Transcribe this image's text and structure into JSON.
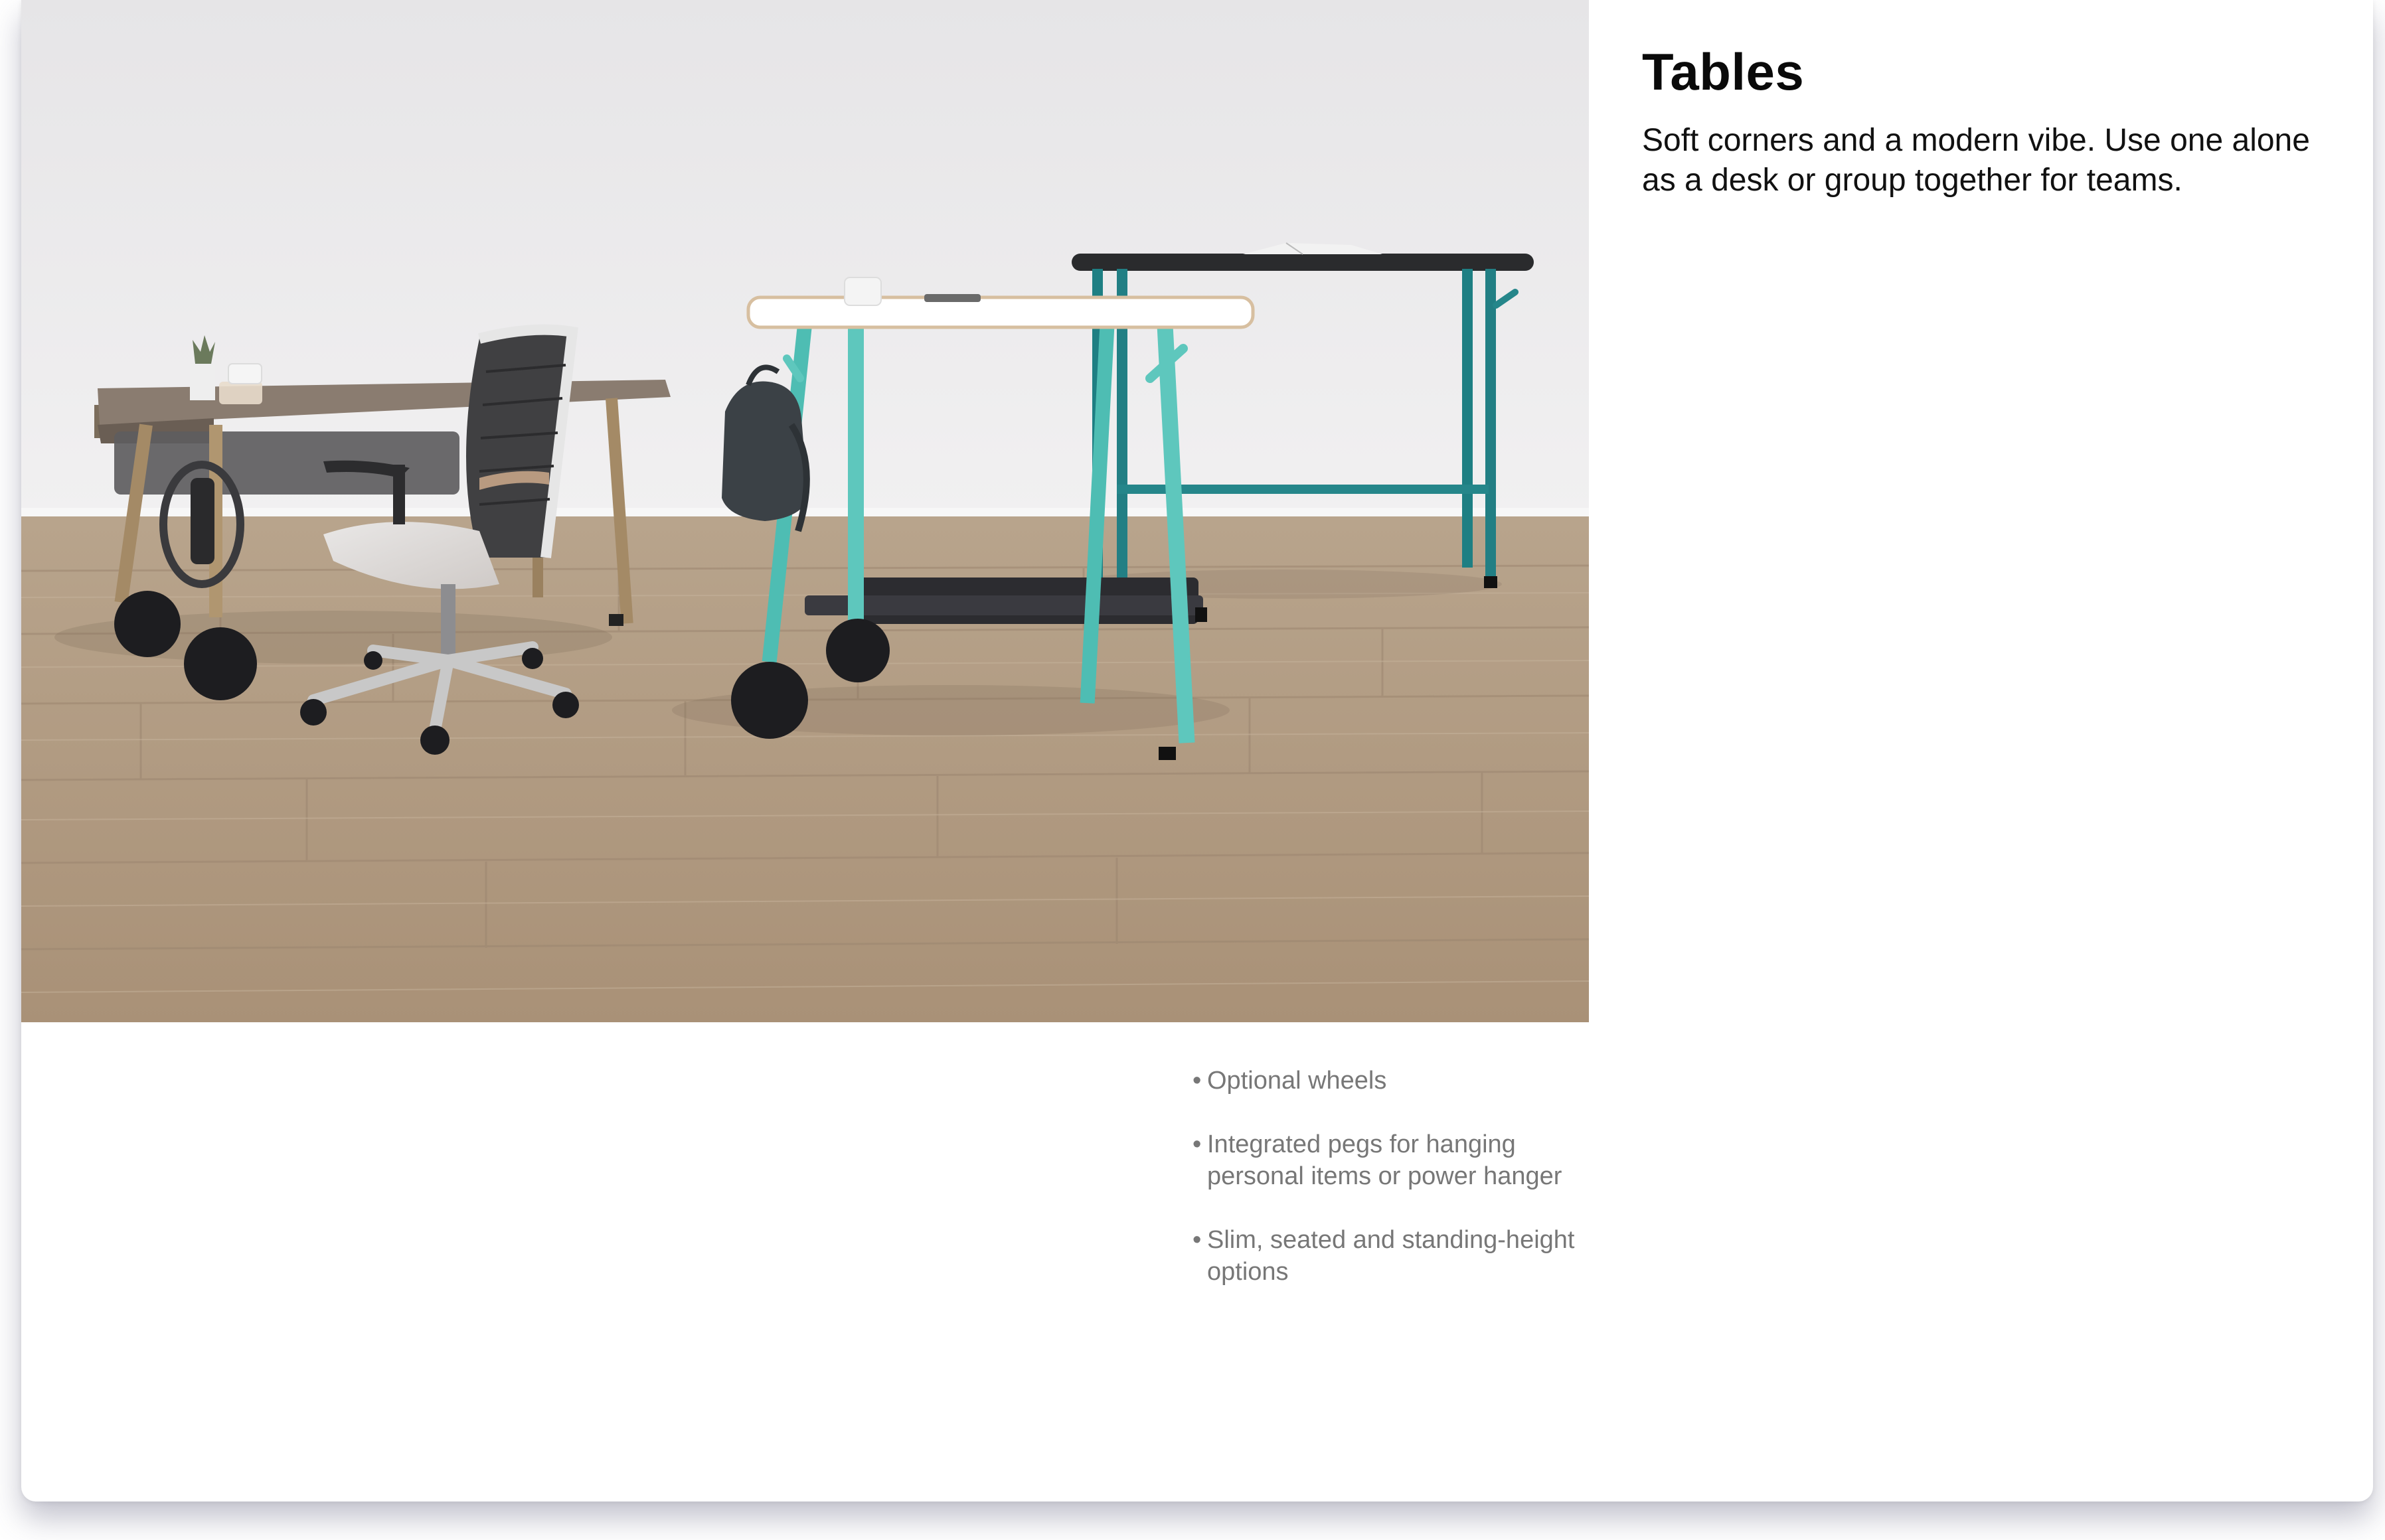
{
  "page": {
    "title": "Tables",
    "subtitle": "Soft corners and a modern vibe. Use one alone as a desk or group together for teams.",
    "photo_alt": "Office desks",
    "features": [
      "Optional wheels",
      "Integrated pegs for hanging personal items or power hanger",
      "Slim, seated and standing-height options"
    ]
  },
  "colors": {
    "wall": "#ebeaeb",
    "floor": "#b59f86",
    "teal_light": "#5ec7bd",
    "teal_dark": "#1e7f83",
    "walnut_top": "#8a7c70",
    "black_top": "#2a2b2d",
    "white_top": "#ffffff"
  }
}
